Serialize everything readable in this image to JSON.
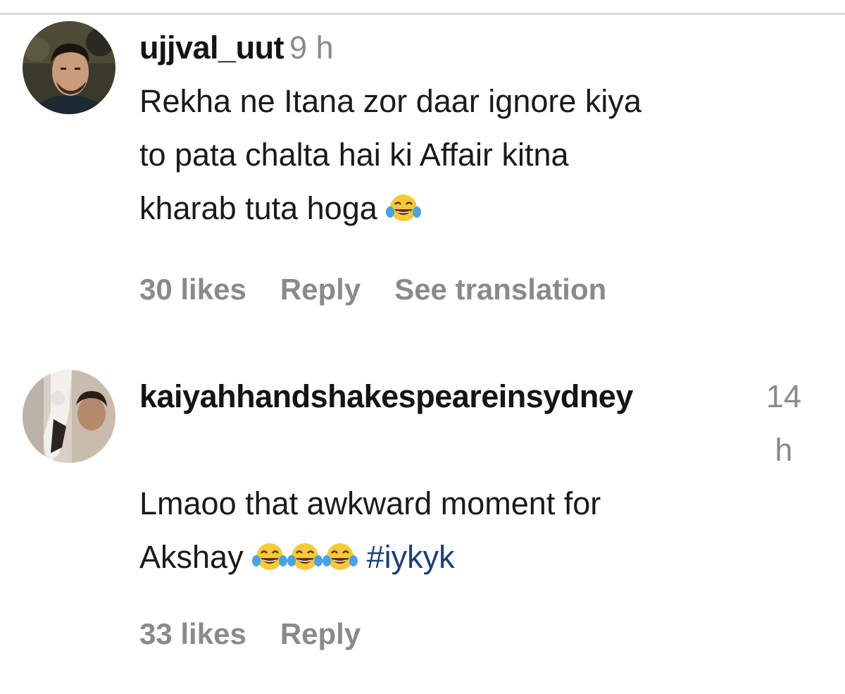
{
  "comments": [
    {
      "username": "ujjval_uut",
      "time": "9 h",
      "text_lines": [
        "Rekha ne Itana zor daar ignore kiya",
        "to pata chalta hai ki Affair kitna",
        "kharab tuta hoga"
      ],
      "likes": "30 likes",
      "reply": "Reply",
      "see_translation": "See translation"
    },
    {
      "username": "kaiyahhandshakespeareinsydney",
      "time_line1": "14",
      "time_line2": "h",
      "text_line1": "Lmaoo that awkward moment for",
      "text_line2_prefix": "Akshay",
      "hashtag": "#iykyk",
      "likes": "33 likes",
      "reply": "Reply"
    }
  ],
  "icons": {
    "avatar_1": "avatar-man-icon",
    "avatar_2": "avatar-girl-cat-icon",
    "emoji": "face-with-tears-of-joy-icon"
  },
  "colors": {
    "username": "#141414",
    "muted": "#8a8a8a",
    "hashtag": "#1c3f74",
    "divider": "#dcdcdc"
  }
}
